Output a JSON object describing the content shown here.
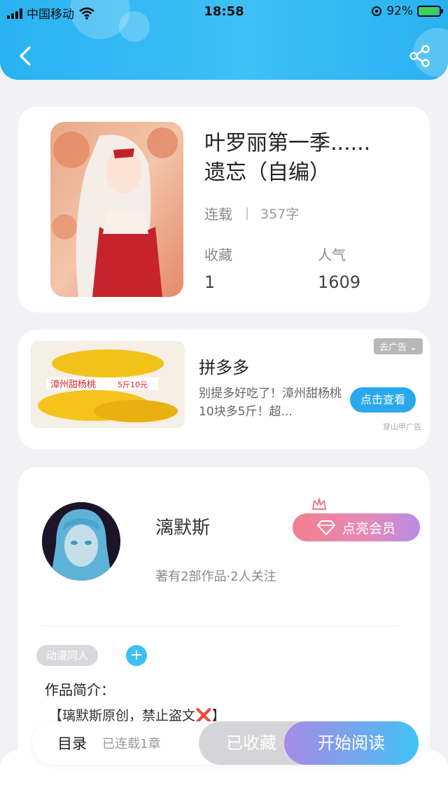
{
  "status_bar": {
    "carrier": "中国移动",
    "time": "18:58",
    "battery": "92%"
  },
  "book": {
    "title_line1": "叶罗丽第一季......",
    "title_line2": "遗忘（自编）",
    "status": "连载",
    "word_count": "357字",
    "favorites_label": "收藏",
    "favorites_value": "1",
    "popularity_label": "人气",
    "popularity_value": "1609"
  },
  "ad": {
    "tag": "去广告 ⌄",
    "title": "拼多多",
    "desc": "别提多好吃了！漳州甜杨桃10块多5斤！超...",
    "button": "点击查看",
    "source": "穿山甲广告",
    "image_text": "漳州甜杨桃",
    "image_price": "5斤10元"
  },
  "author": {
    "name": "漓默斯",
    "info": "著有2部作品·2人关注",
    "vip_button": "点亮会员",
    "tag": "动漫同人",
    "add_tag": "+",
    "intro_label": "作品简介：",
    "intro_text": "【璃默斯原创，禁止盗文❌】"
  },
  "bottom_bar": {
    "toc": "目录",
    "serial": "已连载1章",
    "favorited": "已收藏",
    "start_read": "开始阅读"
  },
  "colors": {
    "header": "#3ec0f7",
    "accent_blue": "#2aa8ee",
    "vip_pink": "#f37e8e"
  }
}
